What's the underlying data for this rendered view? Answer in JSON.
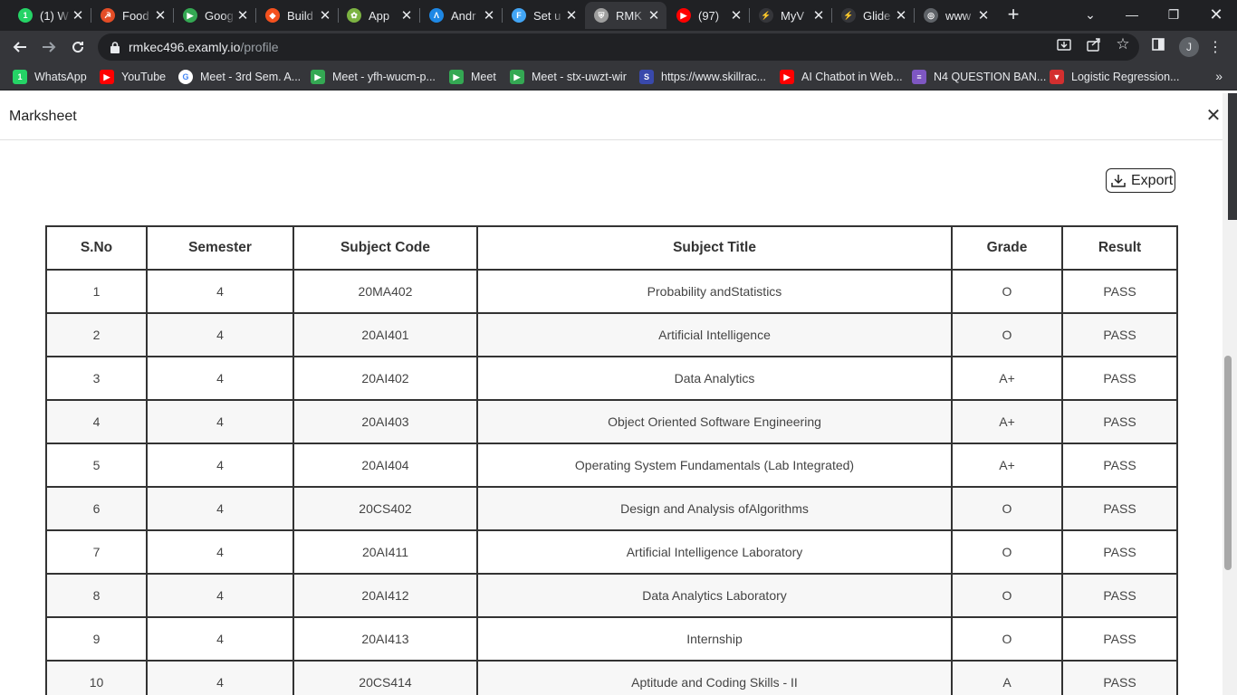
{
  "browser": {
    "tabs": [
      {
        "title": "(1) W",
        "fav_color": "#25d366",
        "fav_glyph": "1",
        "icon": "whatsapp-icon"
      },
      {
        "title": "Food",
        "fav_color": "#e44d26",
        "fav_glyph": "☭",
        "icon": "food-icon"
      },
      {
        "title": "Goog",
        "fav_color": "#34a853",
        "fav_glyph": "▶",
        "icon": "google-meet-icon"
      },
      {
        "title": "Build",
        "fav_color": "#f4511e",
        "fav_glyph": "◆",
        "icon": "build-icon"
      },
      {
        "title": "App",
        "fav_color": "#7cb342",
        "fav_glyph": "✿",
        "icon": "app-icon"
      },
      {
        "title": "Andr",
        "fav_color": "#1e88e5",
        "fav_glyph": "Λ",
        "icon": "android-icon"
      },
      {
        "title": "Set u",
        "fav_color": "#42a5f5",
        "fav_glyph": "F",
        "icon": "flutter-icon"
      },
      {
        "title": "RMK",
        "fav_color": "#9e9e9e",
        "fav_glyph": "⛨",
        "icon": "rmk-shield-icon"
      },
      {
        "title": "(97)",
        "fav_color": "#ff0000",
        "fav_glyph": "▶",
        "icon": "youtube-icon"
      },
      {
        "title": "MyV",
        "fav_color": "#35363a",
        "fav_glyph": "⚡",
        "icon": "bolt-icon"
      },
      {
        "title": "Glide",
        "fav_color": "#35363a",
        "fav_glyph": "⚡",
        "icon": "glide-icon"
      },
      {
        "title": "www",
        "fav_color": "#5f6368",
        "fav_glyph": "◎",
        "icon": "globe-icon"
      }
    ],
    "active_tab_index": 7,
    "url_host": "rmkec496.examly.io",
    "url_path": "/profile",
    "profile_initial": "J",
    "bookmarks": [
      {
        "label": "WhatsApp",
        "color": "#25d366",
        "glyph": "1",
        "icon": "whatsapp-icon"
      },
      {
        "label": "YouTube",
        "color": "#ff0000",
        "glyph": "▶",
        "icon": "youtube-icon"
      },
      {
        "label": "Meet - 3rd Sem. A...",
        "color": "#ffffff",
        "glyph": "G",
        "icon": "google-icon"
      },
      {
        "label": "Meet - yfh-wucm-p...",
        "color": "#34a853",
        "glyph": "▶",
        "icon": "google-meet-icon"
      },
      {
        "label": "Meet",
        "color": "#34a853",
        "glyph": "▶",
        "icon": "google-meet-icon"
      },
      {
        "label": "Meet - stx-uwzt-wir",
        "color": "#34a853",
        "glyph": "▶",
        "icon": "google-meet-icon"
      },
      {
        "label": "https://www.skillrac...",
        "color": "#3949ab",
        "glyph": "S",
        "icon": "skillrack-icon"
      },
      {
        "label": "AI Chatbot in Web...",
        "color": "#ff0000",
        "glyph": "▶",
        "icon": "youtube-icon"
      },
      {
        "label": "N4 QUESTION BAN...",
        "color": "#7e57c2",
        "glyph": "≡",
        "icon": "forms-icon"
      },
      {
        "label": "Logistic Regression...",
        "color": "#d32f2f",
        "glyph": "▼",
        "icon": "vercel-icon"
      }
    ]
  },
  "page": {
    "title": "Marksheet",
    "export_label": "Export"
  },
  "table": {
    "headers": [
      "S.No",
      "Semester",
      "Subject Code",
      "Subject Title",
      "Grade",
      "Result"
    ],
    "rows": [
      [
        "1",
        "4",
        "20MA402",
        "Probability andStatistics",
        "O",
        "PASS"
      ],
      [
        "2",
        "4",
        "20AI401",
        "Artificial Intelligence",
        "O",
        "PASS"
      ],
      [
        "3",
        "4",
        "20AI402",
        "Data Analytics",
        "A+",
        "PASS"
      ],
      [
        "4",
        "4",
        "20AI403",
        "Object Oriented Software Engineering",
        "A+",
        "PASS"
      ],
      [
        "5",
        "4",
        "20AI404",
        "Operating System Fundamentals (Lab Integrated)",
        "A+",
        "PASS"
      ],
      [
        "6",
        "4",
        "20CS402",
        "Design and Analysis ofAlgorithms",
        "O",
        "PASS"
      ],
      [
        "7",
        "4",
        "20AI411",
        "Artificial Intelligence Laboratory",
        "O",
        "PASS"
      ],
      [
        "8",
        "4",
        "20AI412",
        "Data Analytics Laboratory",
        "O",
        "PASS"
      ],
      [
        "9",
        "4",
        "20AI413",
        "Internship",
        "O",
        "PASS"
      ],
      [
        "10",
        "4",
        "20CS414",
        "Aptitude and Coding Skills - II",
        "A",
        "PASS"
      ]
    ]
  }
}
